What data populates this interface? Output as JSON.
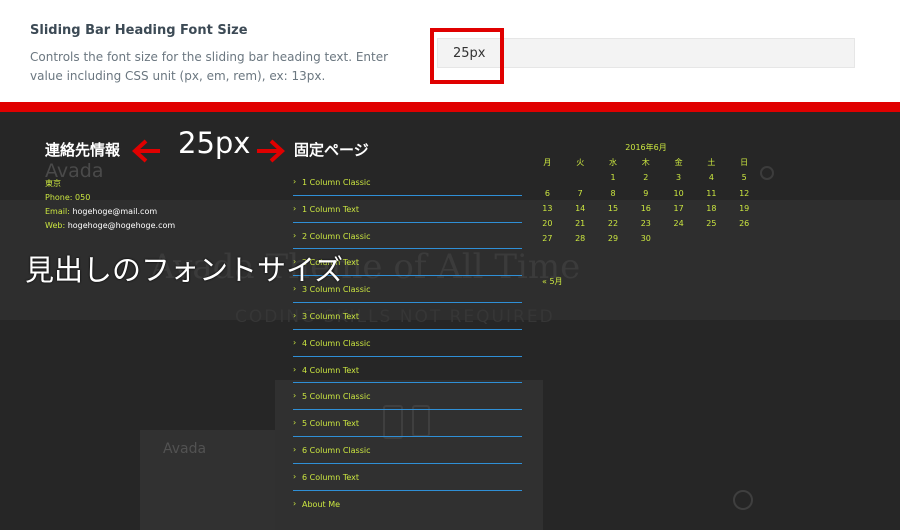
{
  "setting": {
    "title": "Sliding Bar Heading Font Size",
    "description": "Controls the font size for the sliding bar heading text. Enter value including CSS unit (px, em, rem), ex: 13px.",
    "value": "25px"
  },
  "annotations": {
    "size_label": "25px",
    "caption": "見出しのフォントサイズ"
  },
  "colors": {
    "highlight": "#e00000",
    "widget_text": "#cbe640",
    "divider": "#2f8fd6",
    "background": "#262626"
  },
  "background_site": {
    "logo": "Avada",
    "heading": "Avada Theme of All Time",
    "subheading": "CODING SKILLS NOT REQUIRED",
    "logo2": "Avada"
  },
  "contact": {
    "title": "連絡先情報",
    "city": "東京",
    "phone": "Phone: 050",
    "email_label": "Email:",
    "email": "hogehoge@mail.com",
    "web_label": "Web:",
    "web": "hogehoge@hogehoge.com"
  },
  "pages": {
    "title": "固定ページ",
    "items": [
      "1 Column Classic",
      "1 Column Text",
      "2 Column Classic",
      "2 Column Text",
      "3 Column Classic",
      "3 Column Text",
      "4 Column Classic",
      "4 Column Text",
      "5 Column Classic",
      "5 Column Text",
      "6 Column Classic",
      "6 Column Text",
      "About Me"
    ]
  },
  "calendar": {
    "caption": "2016年6月",
    "weekdays": [
      "月",
      "火",
      "水",
      "木",
      "金",
      "土",
      "日"
    ],
    "days": [
      "",
      "",
      "1",
      "2",
      "3",
      "4",
      "5",
      "6",
      "7",
      "8",
      "9",
      "10",
      "11",
      "12",
      "13",
      "14",
      "15",
      "16",
      "17",
      "18",
      "19",
      "20",
      "21",
      "22",
      "23",
      "24",
      "25",
      "26",
      "27",
      "28",
      "29",
      "30",
      "",
      "",
      ""
    ],
    "prev_link": "« 5月"
  }
}
